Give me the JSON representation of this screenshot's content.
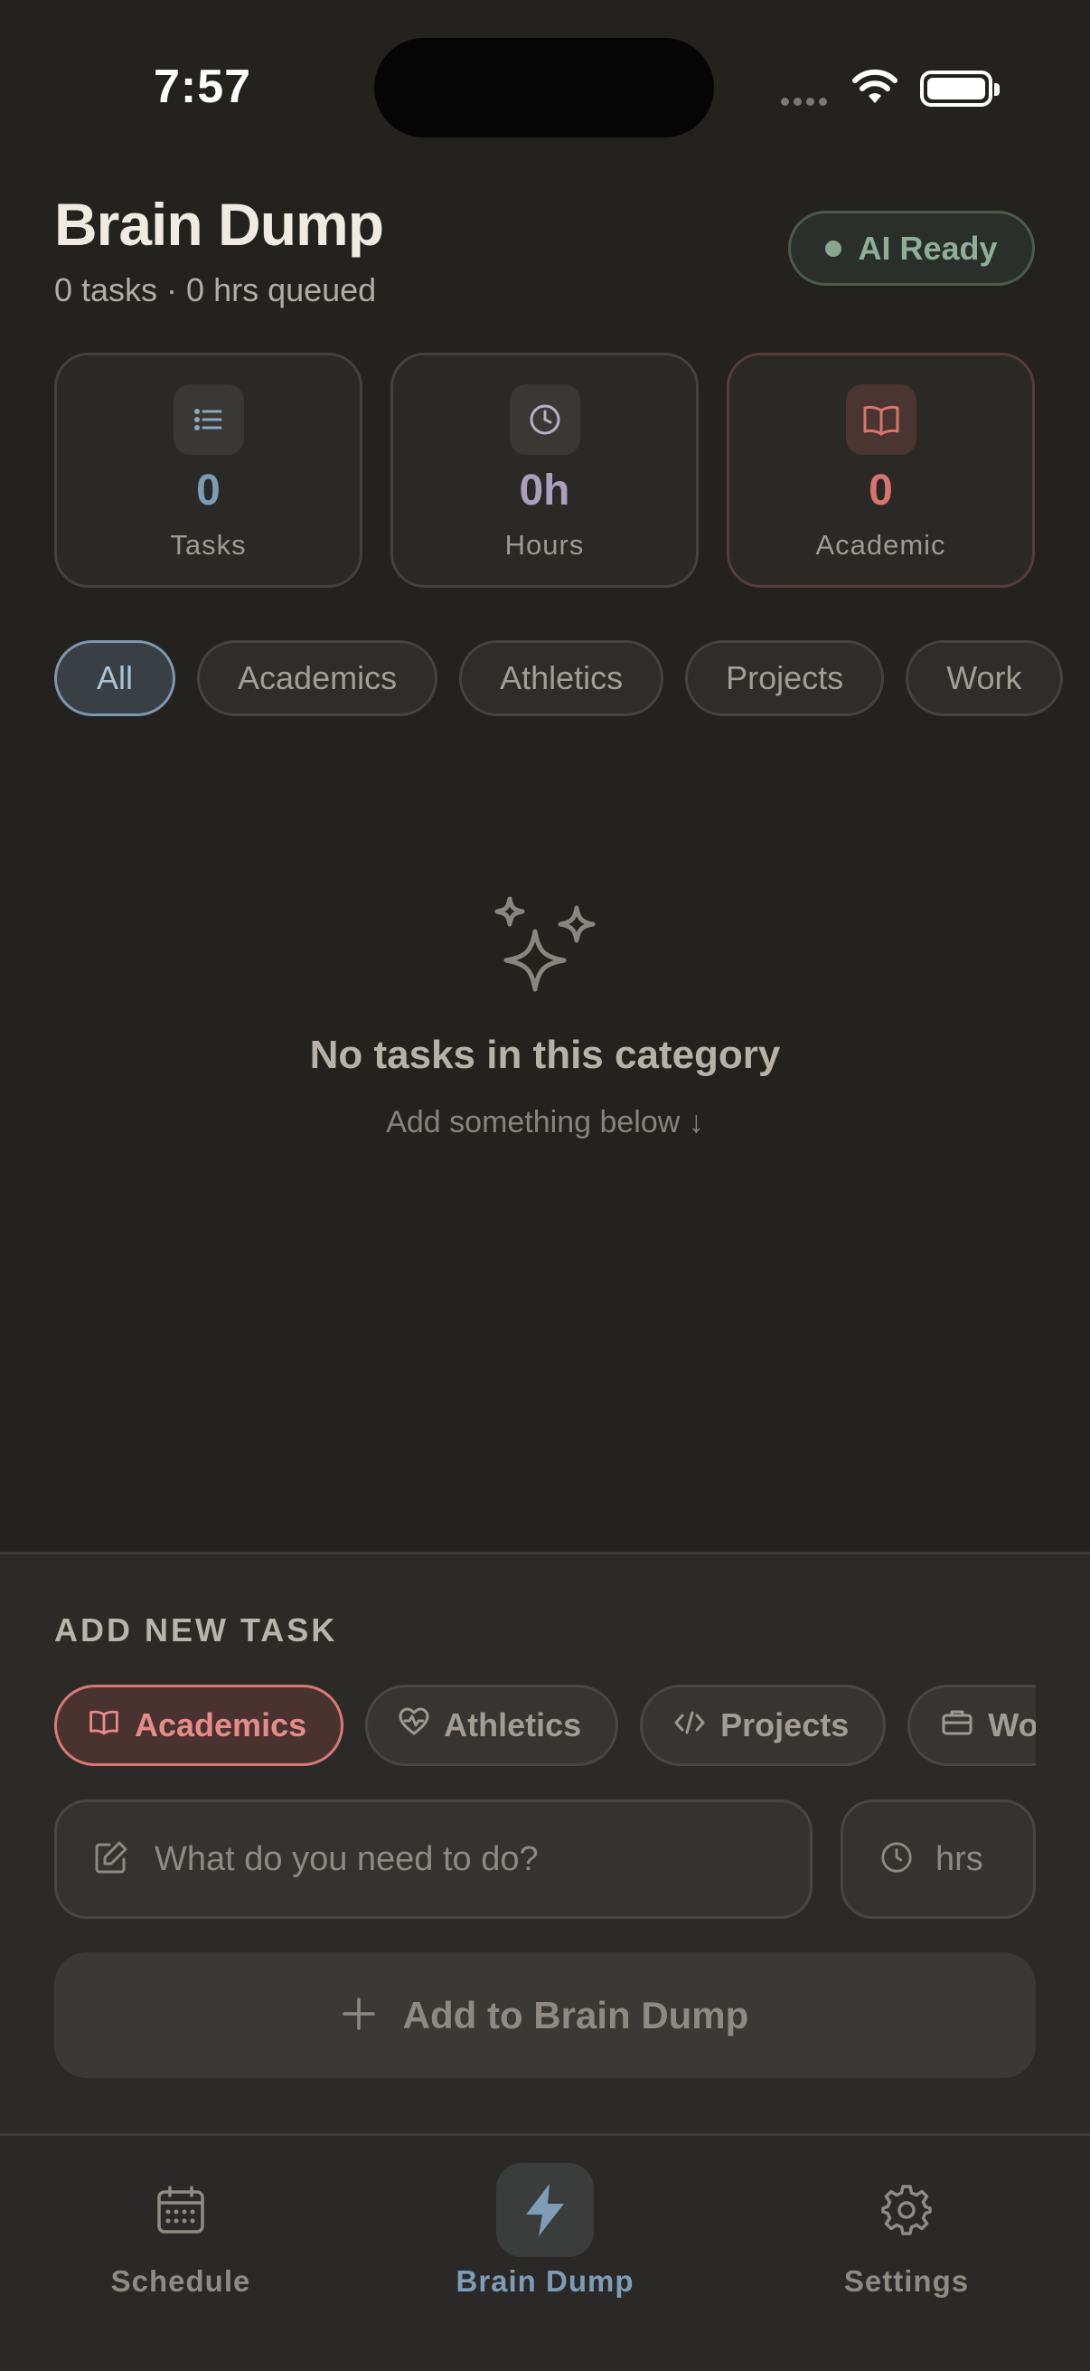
{
  "status_bar": {
    "time": "7:57"
  },
  "header": {
    "title": "Brain Dump",
    "subtitle": "0 tasks · 0 hrs queued",
    "ai_badge": "AI Ready"
  },
  "stats": [
    {
      "icon": "list-icon",
      "value": "0",
      "label": "Tasks",
      "color": "#7d9bb3"
    },
    {
      "icon": "clock-icon",
      "value": "0h",
      "label": "Hours",
      "color": "#aa9fbd"
    },
    {
      "icon": "book-icon",
      "value": "0",
      "label": "Academic",
      "color": "#d9736f"
    }
  ],
  "filters": [
    {
      "label": "All",
      "active": true
    },
    {
      "label": "Academics"
    },
    {
      "label": "Athletics"
    },
    {
      "label": "Projects"
    },
    {
      "label": "Work"
    }
  ],
  "empty_state": {
    "icon": "sparkles-icon",
    "title": "No tasks in this category",
    "subtitle": "Add something below ↓"
  },
  "add_task": {
    "section_title": "ADD NEW TASK",
    "categories": [
      {
        "label": "Academics",
        "icon": "book-icon",
        "active": true,
        "color": "#e58c89"
      },
      {
        "label": "Athletics",
        "icon": "heart-pulse-icon"
      },
      {
        "label": "Projects",
        "icon": "code-icon"
      },
      {
        "label": "Work",
        "icon": "briefcase-icon"
      }
    ],
    "task_placeholder": "What do you need to do?",
    "hours_placeholder": "hrs",
    "submit_label": "Add to Brain Dump"
  },
  "tab_bar": [
    {
      "label": "Schedule",
      "icon": "calendar-icon"
    },
    {
      "label": "Brain Dump",
      "icon": "bolt-icon",
      "active": true,
      "color": "#7e9cb5"
    },
    {
      "label": "Settings",
      "icon": "gear-icon"
    }
  ]
}
